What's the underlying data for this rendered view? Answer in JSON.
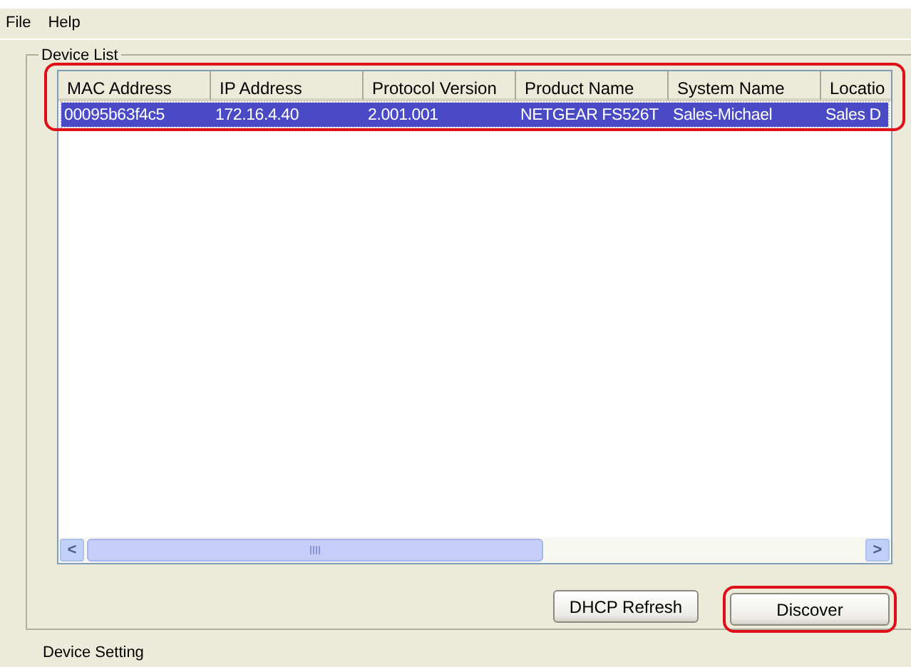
{
  "menu": [
    "File",
    "Help"
  ],
  "device_list": {
    "title": "Device List",
    "highlighted": true,
    "columns": [
      "MAC Address",
      "IP Address",
      "Protocol Version",
      "Product Name",
      "System Name",
      "Locatio"
    ],
    "rows": [
      {
        "selected": true,
        "cells": [
          "00095b63f4c5",
          "172.16.4.40",
          "2.001.001",
          "NETGEAR FS526T",
          "Sales-Michael",
          "Sales D"
        ]
      }
    ],
    "scroll_arrows": [
      "<",
      ">"
    ]
  },
  "buttons": [
    {
      "label": "DHCP Refresh",
      "highlighted": false
    },
    {
      "label": "Discover",
      "highlighted": true
    }
  ],
  "device_setting": {
    "title": "Device Setting"
  }
}
